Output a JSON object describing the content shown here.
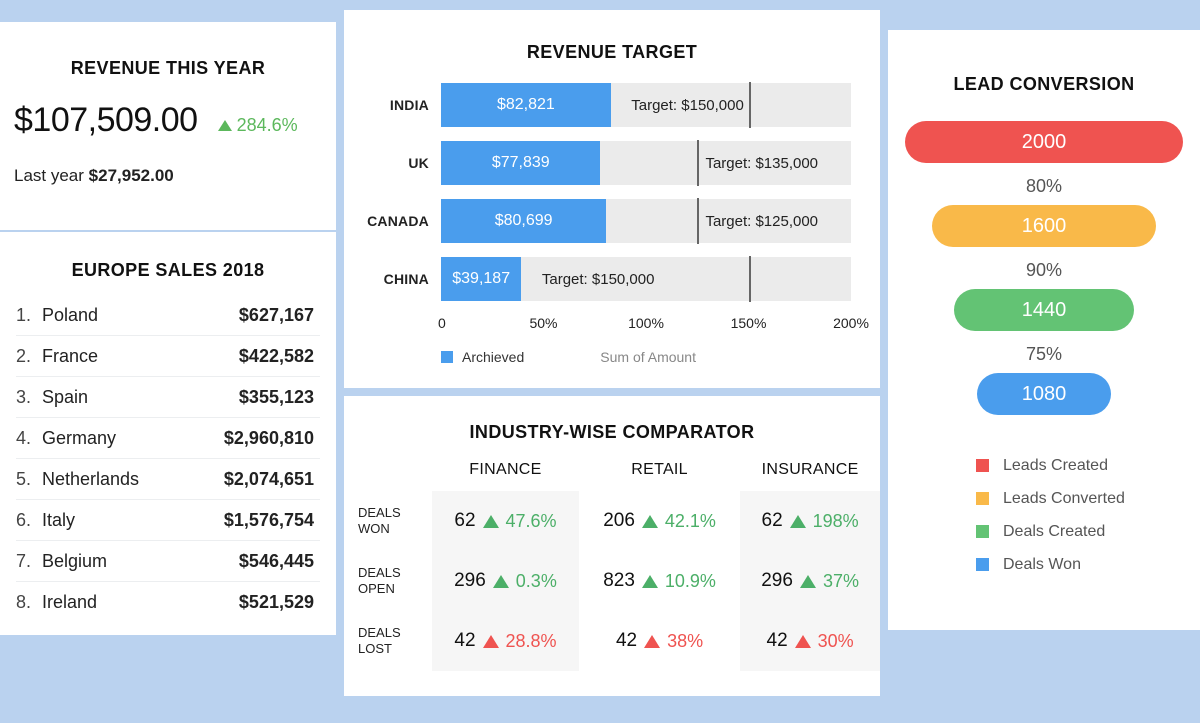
{
  "theme": {
    "page_bg": "#bad2ef",
    "card_bg": "#ffffff",
    "blue": "#4a9ded",
    "green": "#4caf68",
    "red": "#ef5350",
    "amber": "#f9b949",
    "funnel_green": "#63c374",
    "track_gray": "#ebebeb"
  },
  "revenue": {
    "title": "REVENUE THIS YEAR",
    "amount": "$107,509.00",
    "delta": "284.6%",
    "delta_direction": "up",
    "last_year_label": "Last year",
    "last_year_amount": "$27,952.00"
  },
  "europe": {
    "title": "EUROPE SALES 2018",
    "rows": [
      {
        "rank": "1.",
        "country": "Poland",
        "value": "$627,167"
      },
      {
        "rank": "2.",
        "country": "France",
        "value": "$422,582"
      },
      {
        "rank": "3.",
        "country": "Spain",
        "value": "$355,123"
      },
      {
        "rank": "4.",
        "country": "Germany",
        "value": "$2,960,810"
      },
      {
        "rank": "5.",
        "country": "Netherlands",
        "value": "$2,074,651"
      },
      {
        "rank": "6.",
        "country": "Italy",
        "value": "$1,576,754"
      },
      {
        "rank": "7.",
        "country": "Belgium",
        "value": "$546,445"
      },
      {
        "rank": "8.",
        "country": "Ireland",
        "value": "$521,529"
      }
    ]
  },
  "target": {
    "title": "REVENUE TARGET",
    "legend_series": "Archieved",
    "legend_note": "Sum of Amount",
    "axis_ticks": [
      "0",
      "50%",
      "100%",
      "150%",
      "200%"
    ],
    "rows": [
      {
        "label": "INDIA",
        "value": "$82,821",
        "target_label": "Target: $150,000",
        "fill_pct": 41.4,
        "marker_pct": 75.0
      },
      {
        "label": "UK",
        "value": "$77,839",
        "target_label": "Target: $135,000",
        "fill_pct": 38.9,
        "marker_pct": 62.5
      },
      {
        "label": "CANADA",
        "value": "$80,699",
        "target_label": "Target: $125,000",
        "fill_pct": 40.3,
        "marker_pct": 62.5
      },
      {
        "label": "CHINA",
        "value": "$39,187",
        "target_label": "Target: $150,000",
        "fill_pct": 19.6,
        "marker_pct": 75.0
      }
    ]
  },
  "industry": {
    "title": "INDUSTRY-WISE COMPARATOR",
    "columns": [
      "FINANCE",
      "RETAIL",
      "INSURANCE"
    ],
    "rows": [
      {
        "label_line1": "DEALS",
        "label_line2": "WON",
        "cells": [
          {
            "count": "62",
            "pct": "47.6%",
            "direction": "up"
          },
          {
            "count": "206",
            "pct": "42.1%",
            "direction": "up"
          },
          {
            "count": "62",
            "pct": "198%",
            "direction": "up"
          }
        ]
      },
      {
        "label_line1": "DEALS",
        "label_line2": "OPEN",
        "cells": [
          {
            "count": "296",
            "pct": "0.3%",
            "direction": "up"
          },
          {
            "count": "823",
            "pct": "10.9%",
            "direction": "up"
          },
          {
            "count": "296",
            "pct": "37%",
            "direction": "up"
          }
        ]
      },
      {
        "label_line1": "DEALS",
        "label_line2": "LOST",
        "cells": [
          {
            "count": "42",
            "pct": "28.8%",
            "direction": "down"
          },
          {
            "count": "42",
            "pct": "38%",
            "direction": "down"
          },
          {
            "count": "42",
            "pct": "30%",
            "direction": "down"
          }
        ]
      }
    ]
  },
  "lead": {
    "title": "LEAD CONVERSION",
    "stages": [
      {
        "value": "2000",
        "pct": "",
        "color": "#ef5350",
        "width_pct": 89
      },
      {
        "value": "1600",
        "pct": "80%",
        "color": "#f9b949",
        "width_pct": 72
      },
      {
        "value": "1440",
        "pct": "90%",
        "color": "#63c374",
        "width_pct": 58
      },
      {
        "value": "1080",
        "pct": "75%",
        "color": "#4a9ded",
        "width_pct": 43
      }
    ],
    "legend": [
      {
        "label": "Leads Created",
        "color": "#ef5350"
      },
      {
        "label": "Leads Converted",
        "color": "#f9b949"
      },
      {
        "label": "Deals Created",
        "color": "#63c374"
      },
      {
        "label": "Deals Won",
        "color": "#4a9ded"
      }
    ]
  },
  "chart_data": [
    {
      "type": "bar",
      "title": "REVENUE TARGET",
      "orientation": "horizontal",
      "categories": [
        "INDIA",
        "UK",
        "CANADA",
        "CHINA"
      ],
      "series": [
        {
          "name": "Archieved",
          "values": [
            82821,
            77839,
            80699,
            39187
          ]
        },
        {
          "name": "Target",
          "values": [
            150000,
            135000,
            125000,
            150000
          ]
        }
      ],
      "xlabel": "",
      "ylabel": "",
      "axis_ticks": [
        "0",
        "50%",
        "100%",
        "150%",
        "200%"
      ],
      "xlim": [
        0,
        200
      ],
      "grid": false,
      "legend_position": "bottom",
      "annotations": [
        "Sum of Amount"
      ]
    },
    {
      "type": "bar",
      "title": "LEAD CONVERSION",
      "orientation": "funnel",
      "categories": [
        "Leads Created",
        "Leads Converted",
        "Deals Created",
        "Deals Won"
      ],
      "values": [
        2000,
        1600,
        1440,
        1080
      ],
      "conversion_rates": [
        "",
        "80%",
        "90%",
        "75%"
      ],
      "legend_position": "bottom",
      "grid": false
    },
    {
      "type": "table",
      "title": "INDUSTRY-WISE COMPARATOR",
      "columns": [
        "",
        "FINANCE",
        "RETAIL",
        "INSURANCE"
      ],
      "rows": [
        [
          "DEALS WON",
          "62 ▲47.6%",
          "206 ▲42.1%",
          "62 ▲198%"
        ],
        [
          "DEALS OPEN",
          "296 ▲0.3%",
          "823 ▲10.9%",
          "296 ▲37%"
        ],
        [
          "DEALS LOST",
          "42 ▲28.8%",
          "42 ▲38%",
          "42 ▲30%"
        ]
      ]
    },
    {
      "type": "table",
      "title": "EUROPE SALES 2018",
      "columns": [
        "Rank",
        "Country",
        "Sales"
      ],
      "rows": [
        [
          "1",
          "Poland",
          627167
        ],
        [
          "2",
          "France",
          422582
        ],
        [
          "3",
          "Spain",
          355123
        ],
        [
          "4",
          "Germany",
          2960810
        ],
        [
          "5",
          "Netherlands",
          2074651
        ],
        [
          "6",
          "Italy",
          1576754
        ],
        [
          "7",
          "Belgium",
          546445
        ],
        [
          "8",
          "Ireland",
          521529
        ]
      ]
    }
  ]
}
